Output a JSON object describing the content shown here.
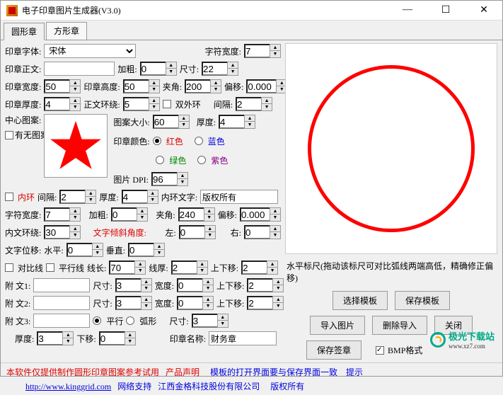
{
  "title": "电子印章图片生成器(V3.0)",
  "tabs": [
    "圆形章",
    "方形章"
  ],
  "l": {
    "font": "印章字体:",
    "font_v": "宋体",
    "charw": "字符宽度:",
    "charw_v": "7",
    "body": "印章正文:",
    "bold": "加粗:",
    "bold_v": "0",
    "size": "尺寸:",
    "size_v": "22",
    "sealw": "印章宽度:",
    "sealw_v": "50",
    "sealh": "印章高度:",
    "sealh_v": "50",
    "angle": "夹角:",
    "angle_v": "200",
    "offset": "偏移:",
    "offset_v": "0.000",
    "thick": "印章厚度:",
    "thick_v": "4",
    "wrap": "正文环绕:",
    "wrap_v": "5",
    "double": "双外环",
    "gap": "间隔:",
    "gap_v": "2",
    "center": "中心图案:",
    "nopic": "有无图案",
    "picsize": "图案大小:",
    "picsize_v": "60",
    "thick2": "厚度:",
    "thick2_v": "4",
    "color": "印章颜色:",
    "c_red": "红色",
    "c_blue": "蓝色",
    "c_green": "绿色",
    "c_purple": "紫色",
    "dpi": "图片 DPI:",
    "dpi_v": "96",
    "inner": "内环",
    "inner_gap": "间隔:",
    "inner_gap_v": "2",
    "inner_thick": "厚度:",
    "inner_thick_v": "4",
    "inner_text": "内环文字:",
    "inner_text_v": "版权所有",
    "r2_charw_v": "7",
    "r2_bold_v": "0",
    "r2_angle_v": "240",
    "r2_offset_v": "0.000",
    "wrap2": "内文环绕:",
    "wrap2_v": "30",
    "tilt": "文字倾斜角度:",
    "tilt_l": "左:",
    "tilt_l_v": "0",
    "tilt_r": "右:",
    "tilt_r_v": "0",
    "pos": "文字位移:",
    "pos_h": "水平:",
    "pos_h_v": "0",
    "pos_v": "垂直:",
    "pos_v_v": "0",
    "contrast": "对比线",
    "parallel": "平行线",
    "linelen": "线长:",
    "linelen_v": "70",
    "linet": "线厚:",
    "linet_v": "2",
    "lineup": "上下移:",
    "lineup_v": "2",
    "att1": "附  文1:",
    "att1_size_v": "3",
    "att1_w_v": "0",
    "att1_ud_v": "2",
    "att2": "附  文2:",
    "att2_size_v": "3",
    "att2_w_v": "0",
    "att2_ud_v": "2",
    "att3": "附  文3:",
    "opt_par": "平行",
    "opt_arc": "弧形",
    "att3_size_v": "3",
    "r_thick": "厚度:",
    "r_thick_v": "3",
    "r_down": "下移:",
    "r_down_v": "0",
    "sealname": "印章名称:",
    "sealname_v": "财务章",
    "widthlbl": "宽度:"
  },
  "r": {
    "ruler": "水平标尺(拖动该标尺可对比弧线两端高低，精确修正偏移)",
    "btn_tpl": "选择模板",
    "btn_save_tpl": "保存模板",
    "btn_import": "导入图片",
    "btn_del": "删除导入",
    "btn_close": "关闭",
    "btn_save_sig": "保存签章",
    "bmp": "BMP格式"
  },
  "footer": {
    "l1a": "本软件仅提供制作圆形印章图案参考试用",
    "l1b": "产品声明",
    "l1c": "模板的打开界面要与保存界面一致",
    "l1d": "提示",
    "l2a": "http://www.kinggrid.com",
    "l2b": "网络支持",
    "l2c": "江西金格科技股份有限公司",
    "l2d": "版权所有"
  },
  "logo": {
    "name": "极光下载站",
    "url": "www.xz7.com"
  }
}
